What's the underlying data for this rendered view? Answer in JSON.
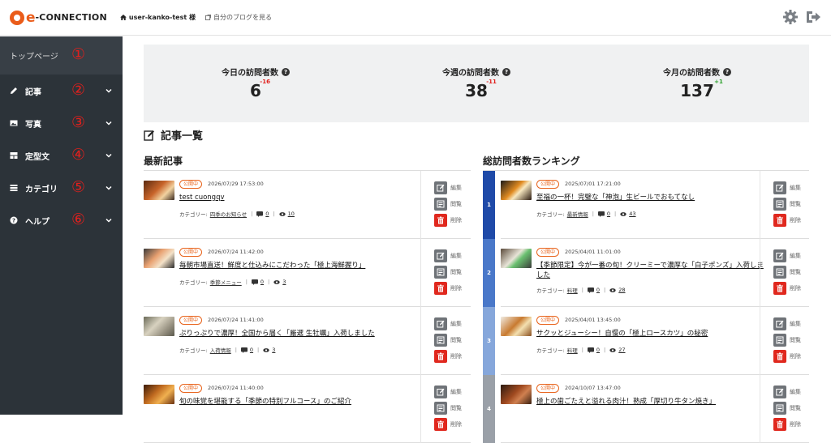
{
  "header": {
    "logo_e": "e",
    "logo_text": "-CONNECTION",
    "user": "user-kanko-test 様",
    "blog_link": "自分のブログを見る",
    "settings_icon": "gear-icon",
    "logout_icon": "logout-icon"
  },
  "sidebar": {
    "top": {
      "label": "トップページ",
      "num": "①"
    },
    "items": [
      {
        "label": "記事",
        "num": "②",
        "icon": "pencil-icon"
      },
      {
        "label": "写真",
        "num": "③",
        "icon": "image-icon"
      },
      {
        "label": "定型文",
        "num": "④",
        "icon": "template-icon"
      },
      {
        "label": "カテゴリ",
        "num": "⑤",
        "icon": "list-icon"
      },
      {
        "label": "ヘルプ",
        "num": "⑥",
        "icon": "help-icon"
      }
    ]
  },
  "stats": [
    {
      "label": "今日の訪問者数",
      "value": "6",
      "delta": "-16",
      "trend": "down"
    },
    {
      "label": "今週の訪問者数",
      "value": "38",
      "delta": "-11",
      "trend": "down"
    },
    {
      "label": "今月の訪問者数",
      "value": "137",
      "delta": "+1",
      "trend": "up"
    }
  ],
  "page_title": "記事一覧",
  "latest": {
    "title": "最新記事",
    "articles": [
      {
        "status": "公開中",
        "date": "2026/07/29 17:53:00",
        "title": "test cuongqv",
        "category": "四季のお知らせ",
        "comments": "0",
        "views": "10"
      },
      {
        "status": "公開中",
        "date": "2026/07/24 11:42:00",
        "title": "毎朝市場直送！鮮度と仕込みにこだわった「極上海鮮握り」",
        "category": "季節メニュー",
        "comments": "0",
        "views": "3"
      },
      {
        "status": "公開中",
        "date": "2026/07/24 11:41:00",
        "title": "ぷりっぷりで濃厚！全国から届く「厳選 生牡蠣」入荷しました",
        "category": "入荷情報",
        "comments": "0",
        "views": "3"
      },
      {
        "status": "公開中",
        "date": "2026/07/24 11:40:00",
        "title": "旬の味覚を堪能する「季節の特別フルコース」のご紹介",
        "category": "",
        "comments": "",
        "views": ""
      }
    ]
  },
  "ranking": {
    "title": "総訪問者数ランキング",
    "articles": [
      {
        "rank": "1",
        "status": "公開中",
        "date": "2025/07/01 17:21:00",
        "title": "至福の一杯！完璧な「神泡」生ビールでおもてなし",
        "category": "最新情報",
        "comments": "0",
        "views": "43"
      },
      {
        "rank": "2",
        "status": "公開中",
        "date": "2025/04/01 11:01:00",
        "title": "【季節限定】今が一番の旬！クリーミーで濃厚な「白子ポンズ」入荷しました",
        "category": "料理",
        "comments": "0",
        "views": "28"
      },
      {
        "rank": "3",
        "status": "公開中",
        "date": "2025/04/01 13:45:00",
        "title": "サクッとジューシー！自慢の「極上ロースカツ」の秘密",
        "category": "料理",
        "comments": "0",
        "views": "27"
      },
      {
        "rank": "4",
        "status": "公開中",
        "date": "2024/10/07 13:47:00",
        "title": "極上の歯ごたえと溢れる肉汁！熟成「厚切り牛タン焼き」",
        "category": "",
        "comments": "",
        "views": ""
      }
    ]
  },
  "labels": {
    "category_prefix": "カテゴリー:",
    "edit": "編集",
    "view": "閲覧",
    "delete": "削除"
  },
  "colors": {
    "accent": "#ea5c1a",
    "sidebar": "#2c3339",
    "delete": "#e0281e",
    "rank1": "#1f4aa8",
    "rank2": "#4a78c9",
    "rank3": "#86a7db",
    "rank4": "#9aa0a8"
  }
}
